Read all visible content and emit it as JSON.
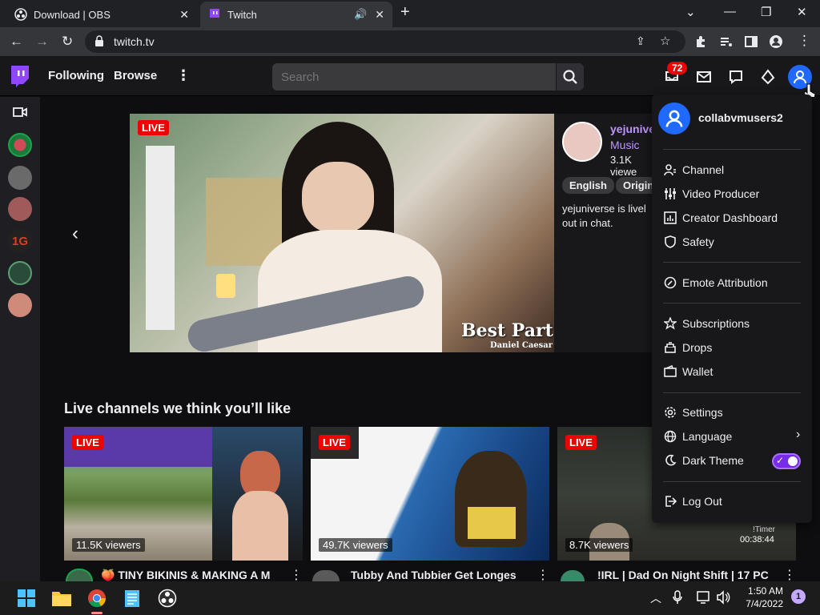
{
  "browser": {
    "tabs": [
      {
        "title": "Download | OBS"
      },
      {
        "title": "Twitch"
      }
    ],
    "url": "twitch.tv"
  },
  "twitch_nav": {
    "following": "Following",
    "browse": "Browse",
    "search_placeholder": "Search",
    "notification_count": "72"
  },
  "hero": {
    "live": "LIVE",
    "channel": "yejunive",
    "category": "Music",
    "viewers": "3.1K viewe",
    "tags": [
      "English",
      "Origin"
    ],
    "description": "yejuniverse is livel out in chat.",
    "overlay_title": "Best Part",
    "overlay_artist": "Daniel Caesar"
  },
  "section": {
    "title": "Live channels we think you’ll like"
  },
  "cards": [
    {
      "live": "LIVE",
      "viewers": "11.5K viewers",
      "title": "🍑 TINY BIKINIS & MAKING A M"
    },
    {
      "live": "LIVE",
      "viewers": "49.7K viewers",
      "title": "Tubby And Tubbier Get Longes"
    },
    {
      "live": "LIVE",
      "viewers": "8.7K viewers",
      "title": "!IRL | Dad On Night Shift | 17 PC",
      "timer_label": "!Timer",
      "timer": "00:38:44"
    }
  ],
  "menu": {
    "username": "collabvmusers2",
    "items": {
      "channel": "Channel",
      "video_producer": "Video Producer",
      "creator_dashboard": "Creator Dashboard",
      "safety": "Safety",
      "emote_attribution": "Emote Attribution",
      "subscriptions": "Subscriptions",
      "drops": "Drops",
      "wallet": "Wallet",
      "settings": "Settings",
      "language": "Language",
      "dark_theme": "Dark Theme",
      "log_out": "Log Out"
    },
    "dark_theme_on": true
  },
  "taskbar": {
    "time": "1:50 AM",
    "date": "7/4/2022",
    "notification_count": "1"
  },
  "colors": {
    "twitch_purple": "#9147ff",
    "live_red": "#eb0400",
    "avatar_blue": "#1f69ff"
  }
}
